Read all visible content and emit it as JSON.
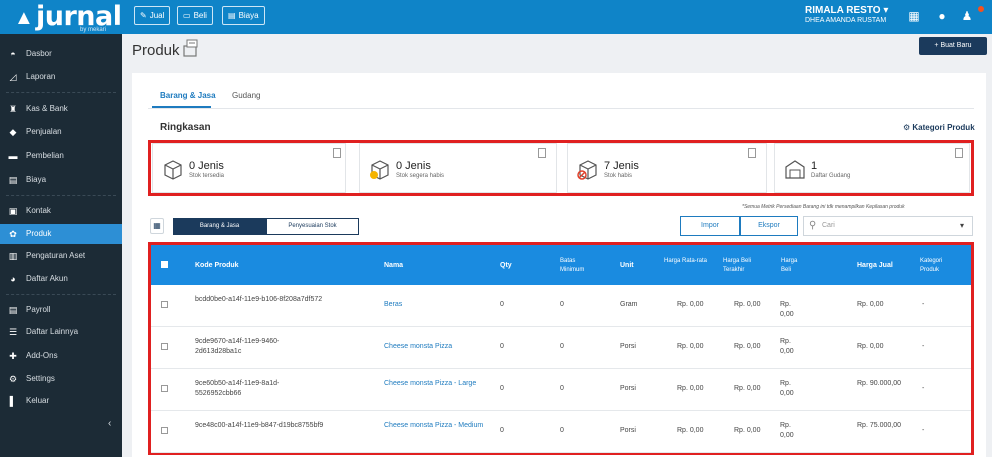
{
  "app": {
    "logo_name": "jurnal",
    "logo_by": "by mekari"
  },
  "topbar": {
    "quick_buttons": [
      {
        "label": "Jual",
        "icon": "tag-icon"
      },
      {
        "label": "Beli",
        "icon": "card-icon"
      },
      {
        "label": "Biaya",
        "icon": "receipt-icon"
      }
    ],
    "company_name": "RIMALA RESTO ▾",
    "user_name": "DHEA AMANDA RUSTAM"
  },
  "sidebar": {
    "items": [
      {
        "label": "Dasbor",
        "icon": "dashboard-icon"
      },
      {
        "label": "Laporan",
        "icon": "chart-icon"
      },
      {
        "label": "Kas & Bank",
        "icon": "bank-icon"
      },
      {
        "label": "Penjualan",
        "icon": "tag-icon"
      },
      {
        "label": "Pembelian",
        "icon": "card-icon"
      },
      {
        "label": "Biaya",
        "icon": "receipt-icon"
      },
      {
        "label": "Kontak",
        "icon": "contact-icon"
      },
      {
        "label": "Produk",
        "icon": "box-icon"
      },
      {
        "label": "Pengaturan Aset",
        "icon": "asset-icon"
      },
      {
        "label": "Daftar Akun",
        "icon": "list-icon"
      },
      {
        "label": "Payroll",
        "icon": "payroll-icon"
      },
      {
        "label": "Daftar Lainnya",
        "icon": "menu-icon"
      },
      {
        "label": "Add-Ons",
        "icon": "puzzle-icon"
      },
      {
        "label": "Settings",
        "icon": "gear-icon"
      },
      {
        "label": "Keluar",
        "icon": "logout-icon"
      }
    ],
    "active": "Produk",
    "collapse_glyph": "‹"
  },
  "page": {
    "title": "Produk",
    "new_button": "+ Buat Baru",
    "tabs": [
      "Barang & Jasa",
      "Gudang"
    ],
    "active_tab": "Barang & Jasa",
    "section_title": "Ringkasan",
    "category_link": "Kategori Produk"
  },
  "summary": [
    {
      "value": "0 Jenis",
      "label": "Stok tersedia"
    },
    {
      "value": "0 Jenis",
      "label": "Stok segera habis"
    },
    {
      "value": "7 Jenis",
      "label": "Stok habis"
    },
    {
      "value": "1",
      "label": "Daftar Gudang"
    }
  ],
  "note": "*Semua Metrik Persediaan Barang ini tdk menampilkan Kepilasan produk",
  "toolbar": {
    "segments": [
      "Barang & Jasa",
      "Penyesuaian Stok"
    ],
    "import_label": "Impor",
    "export_label": "Ekspor",
    "search_placeholder": "Cari"
  },
  "table": {
    "columns": [
      "Kode Produk",
      "Nama",
      "Qty",
      "Batas Minimum",
      "Unit",
      "Harga Rata-rata",
      "Harga Beli Terakhir",
      "Harga Beli",
      "Harga Jual",
      "Kategori Produk"
    ],
    "rows": [
      {
        "kode": "bcdd0be0-a14f-11e9-b106-8f208a7df572",
        "nama": "Beras",
        "qty": "0",
        "batas": "0",
        "unit": "Gram",
        "rata": "Rp. 0,00",
        "terakhir": "Rp. 0,00",
        "beli": "Rp. 0,00",
        "jual": "Rp. 0,00",
        "kategori": "-"
      },
      {
        "kode": "9cde9670-a14f-11e9-9460-2d613d28ba1c",
        "nama": "Cheese monsta Pizza",
        "qty": "0",
        "batas": "0",
        "unit": "Porsi",
        "rata": "Rp. 0,00",
        "terakhir": "Rp. 0,00",
        "beli": "Rp. 0,00",
        "jual": "Rp. 0,00",
        "kategori": "-"
      },
      {
        "kode": "9ce60b50-a14f-11e9-8a1d-5526952cbb66",
        "nama": "Cheese monsta Pizza - Large",
        "qty": "0",
        "batas": "0",
        "unit": "Porsi",
        "rata": "Rp. 0,00",
        "terakhir": "Rp. 0,00",
        "beli": "Rp. 0,00",
        "jual": "Rp. 90.000,00",
        "kategori": "-"
      },
      {
        "kode": "9ce48c00-a14f-11e9-b847-d19bc8755bf9",
        "nama": "Cheese monsta Pizza - Medium",
        "qty": "0",
        "batas": "0",
        "unit": "Porsi",
        "rata": "Rp. 0,00",
        "terakhir": "Rp. 0,00",
        "beli": "Rp. 0,00",
        "jual": "Rp. 75.000,00",
        "kategori": "-"
      }
    ]
  },
  "colors": {
    "brand_blue": "#0f84c8",
    "sidebar_bg": "#1c2b36",
    "header_blue": "#1a8be0",
    "highlight_red": "#e02020",
    "navy": "#1b3a5c"
  }
}
